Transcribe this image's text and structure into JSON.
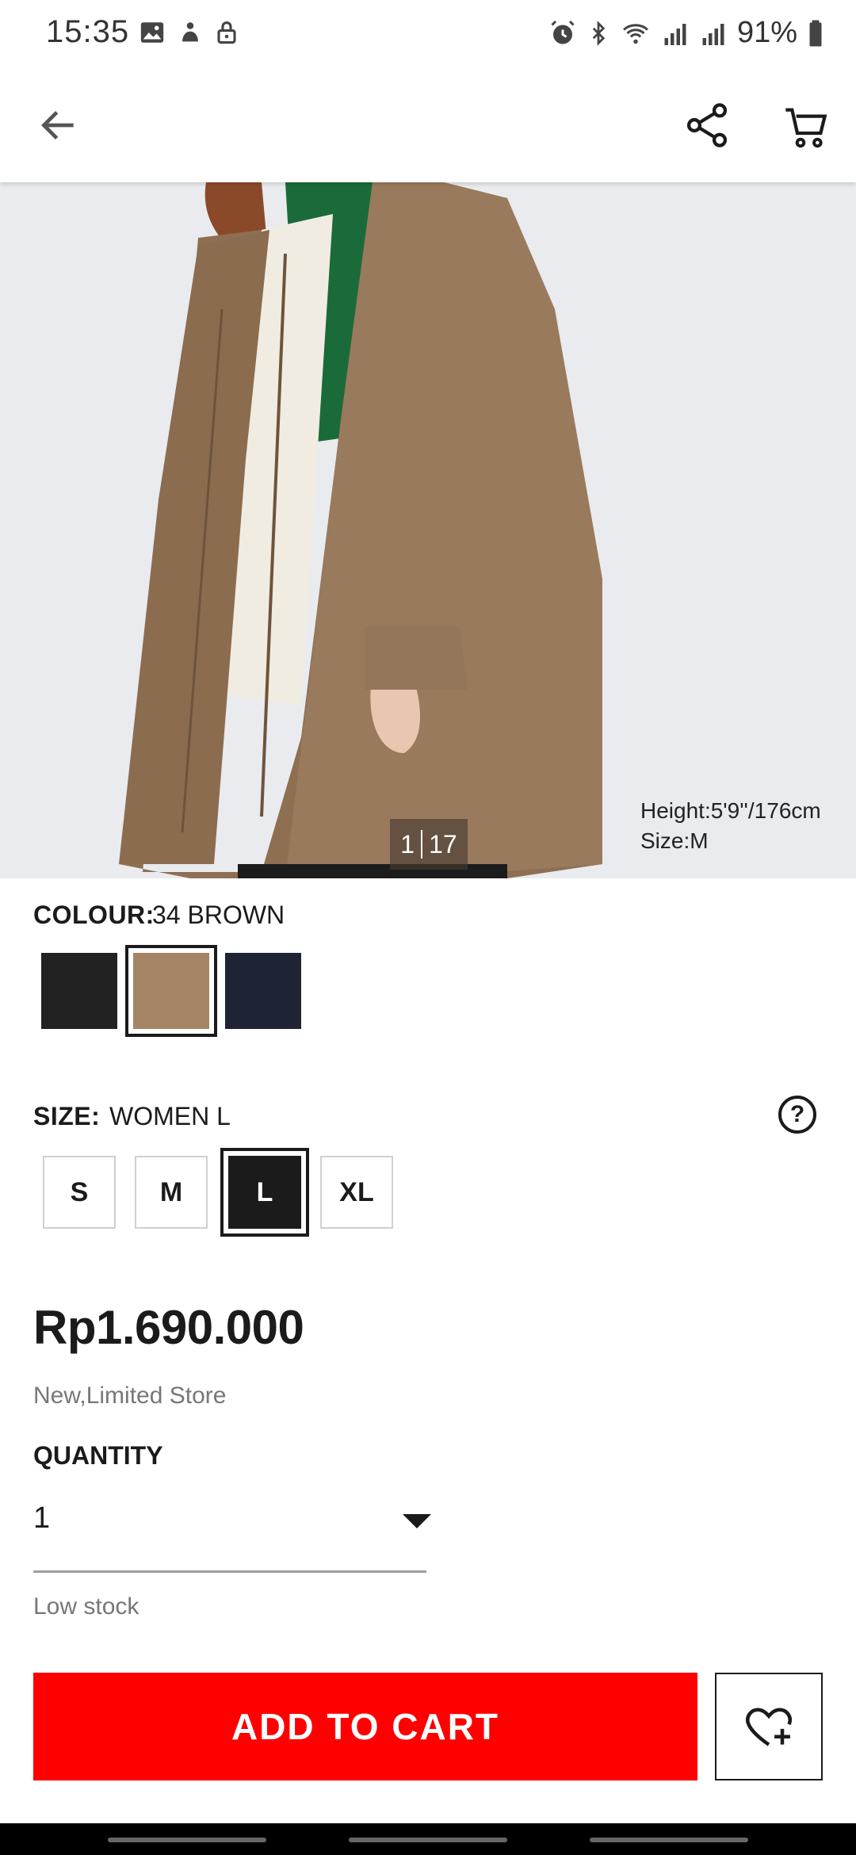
{
  "status_bar": {
    "time": "15:35",
    "battery": "91%"
  },
  "app_bar": {
    "back_icon": "arrow-left-icon",
    "share_icon": "share-icon",
    "cart_icon": "shopping-cart-icon"
  },
  "gallery": {
    "current": "1",
    "total": "17",
    "model_height": "Height:5'9''/176cm",
    "model_size": "Size:M"
  },
  "colour": {
    "label": "COLOUR:",
    "selected": "34 BROWN",
    "swatches": [
      {
        "name": "black",
        "color": "#222222"
      },
      {
        "name": "brown",
        "color": "#a58566"
      },
      {
        "name": "navy",
        "color": "#1e2434"
      }
    ]
  },
  "size": {
    "label": "SIZE:",
    "selected": "WOMEN L",
    "help_icon": "question-circle-icon",
    "options": [
      "S",
      "M",
      "L",
      "XL"
    ],
    "selected_option": "L"
  },
  "price": "Rp1.690.000",
  "tags": "New,Limited Store",
  "quantity": {
    "label": "QUANTITY",
    "value": "1"
  },
  "stock_status": "Low stock",
  "actions": {
    "add_to_cart": "ADD TO CART",
    "wishlist_icon": "heart-plus-icon"
  },
  "colors": {
    "accent": "#ff0000",
    "text": "#1b1b1b"
  }
}
